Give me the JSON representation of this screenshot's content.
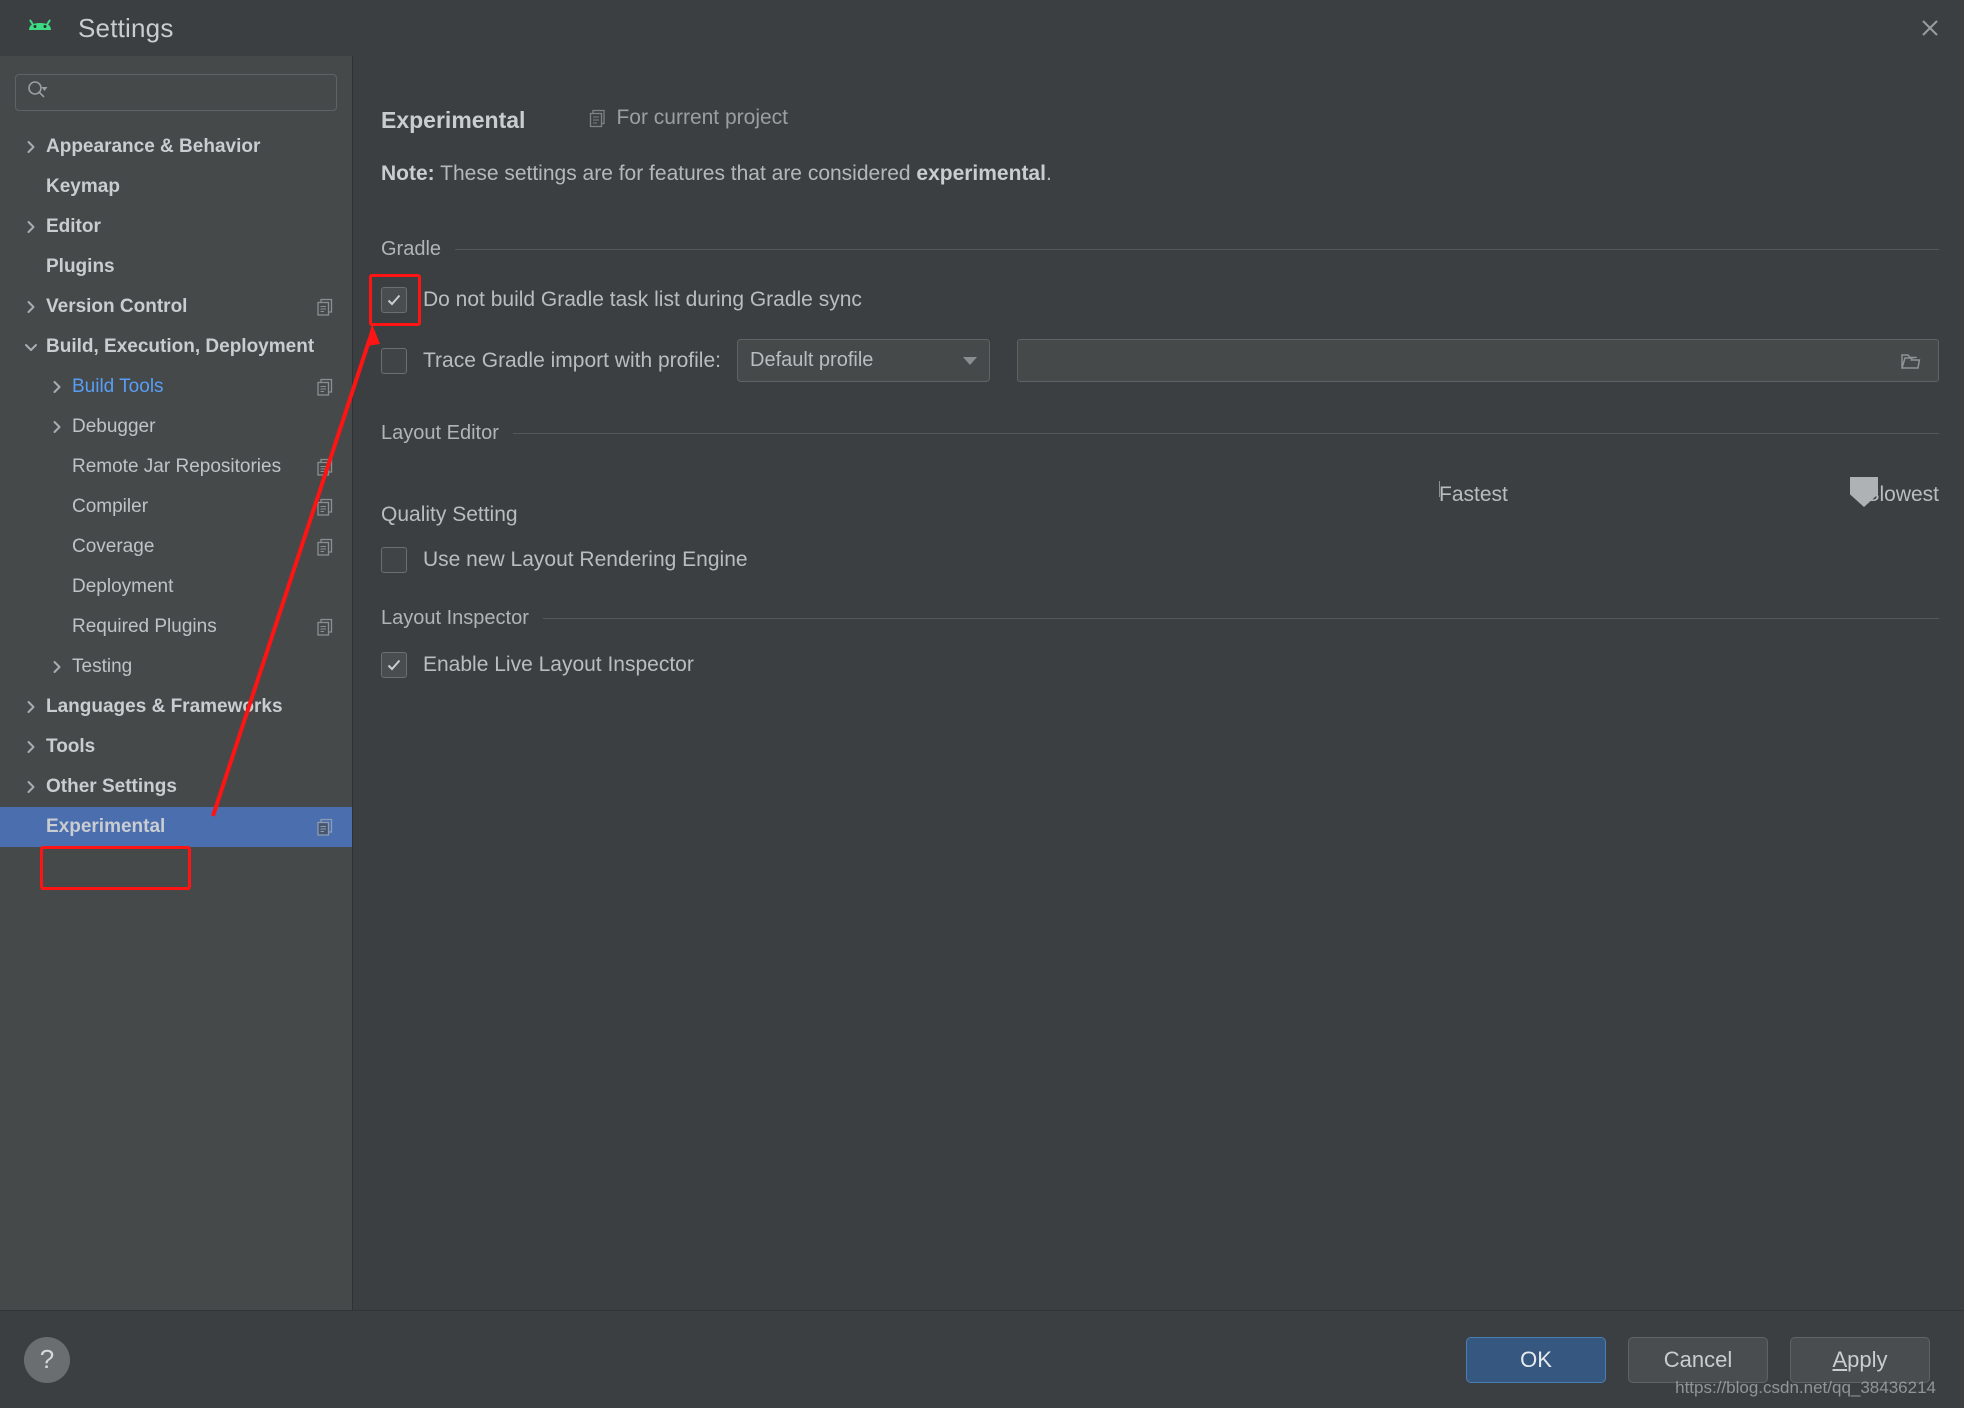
{
  "window": {
    "title": "Settings",
    "app_icon": "android-icon",
    "close_icon": "close-icon"
  },
  "sidebar": {
    "search": {
      "placeholder": "",
      "value": "",
      "icon": "search-icon"
    },
    "items": [
      {
        "label": "Appearance & Behavior",
        "arrow": "right",
        "indent": 0,
        "bold": true,
        "copy": false,
        "selected": false
      },
      {
        "label": "Keymap",
        "arrow": "none",
        "indent": 0,
        "bold": true,
        "copy": false,
        "selected": false
      },
      {
        "label": "Editor",
        "arrow": "right",
        "indent": 0,
        "bold": true,
        "copy": false,
        "selected": false
      },
      {
        "label": "Plugins",
        "arrow": "none",
        "indent": 0,
        "bold": true,
        "copy": false,
        "selected": false
      },
      {
        "label": "Version Control",
        "arrow": "right",
        "indent": 0,
        "bold": true,
        "copy": true,
        "selected": false
      },
      {
        "label": "Build, Execution, Deployment",
        "arrow": "down",
        "indent": 0,
        "bold": true,
        "copy": false,
        "selected": false
      },
      {
        "label": "Build Tools",
        "arrow": "right",
        "indent": 1,
        "bold": false,
        "copy": true,
        "selected": false,
        "link": true
      },
      {
        "label": "Debugger",
        "arrow": "right",
        "indent": 1,
        "bold": false,
        "copy": false,
        "selected": false
      },
      {
        "label": "Remote Jar Repositories",
        "arrow": "none",
        "indent": 1,
        "bold": false,
        "copy": true,
        "selected": false
      },
      {
        "label": "Compiler",
        "arrow": "none",
        "indent": 1,
        "bold": false,
        "copy": true,
        "selected": false
      },
      {
        "label": "Coverage",
        "arrow": "none",
        "indent": 1,
        "bold": false,
        "copy": true,
        "selected": false
      },
      {
        "label": "Deployment",
        "arrow": "none",
        "indent": 1,
        "bold": false,
        "copy": false,
        "selected": false
      },
      {
        "label": "Required Plugins",
        "arrow": "none",
        "indent": 1,
        "bold": false,
        "copy": true,
        "selected": false
      },
      {
        "label": "Testing",
        "arrow": "right",
        "indent": 1,
        "bold": false,
        "copy": false,
        "selected": false
      },
      {
        "label": "Languages & Frameworks",
        "arrow": "right",
        "indent": 0,
        "bold": true,
        "copy": false,
        "selected": false
      },
      {
        "label": "Tools",
        "arrow": "right",
        "indent": 0,
        "bold": true,
        "copy": false,
        "selected": false
      },
      {
        "label": "Other Settings",
        "arrow": "right",
        "indent": 0,
        "bold": true,
        "copy": false,
        "selected": false
      },
      {
        "label": "Experimental",
        "arrow": "none",
        "indent": 0,
        "bold": true,
        "copy": true,
        "selected": true
      }
    ]
  },
  "main": {
    "title": "Experimental",
    "scope_label": "For current project",
    "scope_icon": "copy-icon",
    "note_prefix": "Note:",
    "note_body": " These settings are for features that are considered ",
    "note_emphasis": "experimental",
    "note_suffix": ".",
    "gradle": {
      "section_title": "Gradle",
      "no_task_list_label": "Do not build Gradle task list during Gradle sync",
      "no_task_list_checked": true,
      "trace_label": "Trace Gradle import with profile:",
      "trace_checked": false,
      "profile_value": "Default profile",
      "profile_caret": "chevron-down-icon",
      "path_value": "",
      "path_icon": "folder-icon"
    },
    "layout_editor": {
      "section_title": "Layout Editor",
      "quality_label": "Quality Setting",
      "slider_min_label": "Fastest",
      "slider_max_label": "Slowest",
      "slider_value": 85,
      "rendering_engine_label": "Use new Layout Rendering Engine",
      "rendering_engine_checked": false
    },
    "layout_inspector": {
      "section_title": "Layout Inspector",
      "live_inspector_label": "Enable Live Layout Inspector",
      "live_inspector_checked": true
    }
  },
  "footer": {
    "help_label": "?",
    "ok_label": "OK",
    "cancel_label": "Cancel",
    "apply_label_underline": "A",
    "apply_label_rest": "pply",
    "watermark": "https://blog.csdn.net/qq_38436214"
  },
  "colors": {
    "window_bg": "#3c3f41",
    "sidebar_bg": "#45494a",
    "selection_blue": "#4b6eaf",
    "link_blue": "#589df6",
    "annotation_red": "#ff1414",
    "primary_button": "#365880",
    "android_green": "#3ddc84"
  }
}
